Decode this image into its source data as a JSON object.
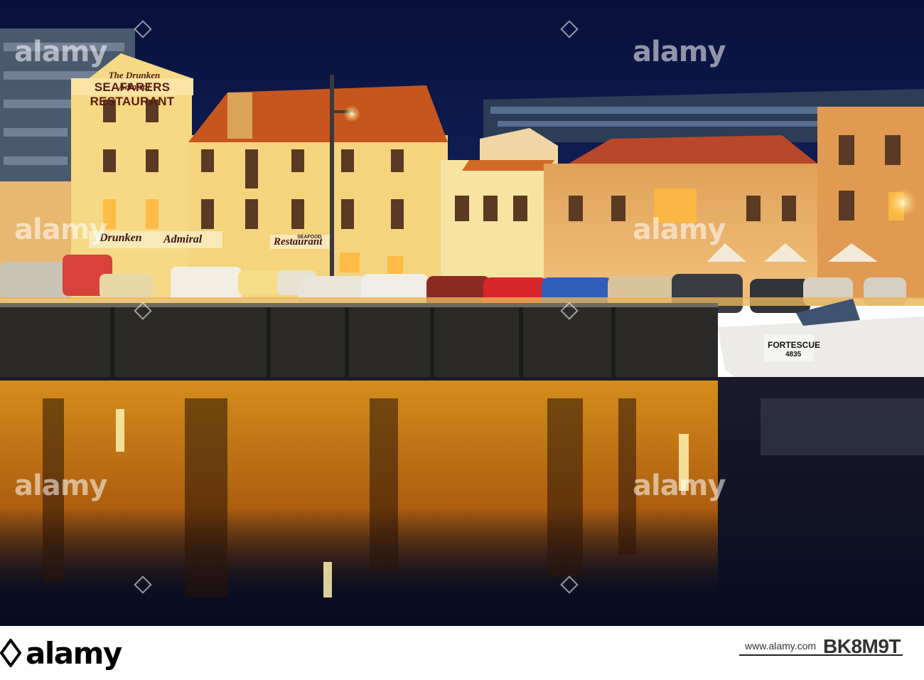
{
  "scene": {
    "signs": {
      "top": "The Drunken Admiral",
      "main": "SEAFARERS RESTAURANT",
      "drunken": "Drunken",
      "admiral": "Admiral",
      "seafood": "SEAFOOD",
      "restaurant": "Restaurant"
    },
    "boat": {
      "name": "FORTESCUE",
      "number": "4835"
    },
    "colors": {
      "sky": "#0c1a4a",
      "building_lit": "#f4d27a",
      "water_reflection": "#e88a12",
      "water_dark": "#0a0f2a"
    }
  },
  "watermark": {
    "text": "alamy"
  },
  "footer": {
    "logo": "alamy",
    "image_id": "BK8M9T",
    "url": "www.alamy.com"
  }
}
